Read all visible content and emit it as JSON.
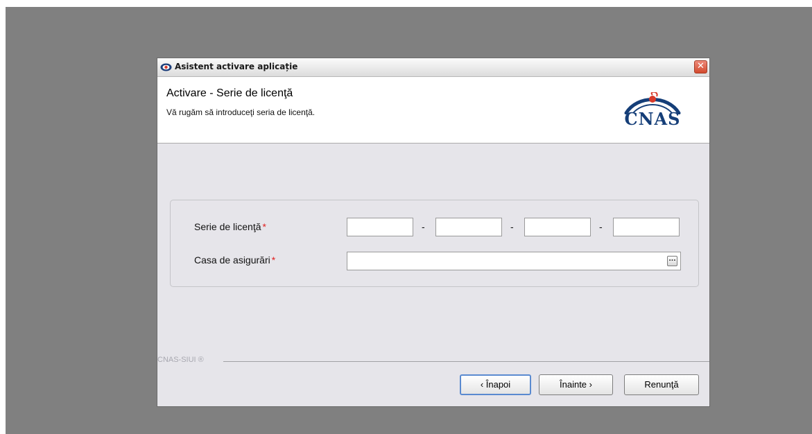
{
  "window": {
    "title": "Asistent activare aplicație",
    "close_symbol": "✕",
    "icon": "cnas-app-icon"
  },
  "header": {
    "title": "Activare - Serie de licenţă",
    "subtitle": "Vă rugăm să introduceţi seria de licenţă.",
    "logo_text": "CNAS",
    "logo_colors": {
      "text": "#153e78",
      "arc": "#153e78",
      "dot": "#d83a2a"
    }
  },
  "form": {
    "serial_label": "Serie de licenţă",
    "casa_label": "Casa de asigurări",
    "required_mark": "*",
    "separator": "-",
    "serial_parts": [
      "",
      "",
      "",
      ""
    ],
    "casa_value": "",
    "browse_label": "..."
  },
  "footer": {
    "brand": "CNAS-SIUI ®",
    "back_label": "‹ Înapoi",
    "next_label": "Înainte ›",
    "cancel_label": "Renunţă"
  },
  "colors": {
    "desktop": "#808080",
    "window_bg": "#e6e5ea",
    "required": "#e02020",
    "focus_border": "#5a8ad0"
  }
}
